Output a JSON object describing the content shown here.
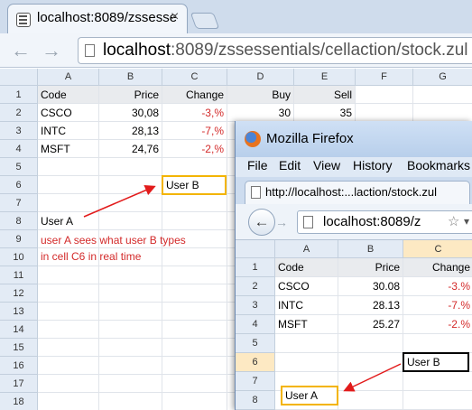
{
  "chrome": {
    "tab_title": "localhost:8089/zssesse",
    "tab_close": "×",
    "back": "←",
    "forward": "→",
    "url_host": "localhost",
    "url_rest": ":8089/zssessentials/cellaction/stock.zul"
  },
  "sheetA": {
    "cols": [
      "A",
      "B",
      "C",
      "D",
      "E",
      "F",
      "G"
    ],
    "rows": [
      "1",
      "2",
      "3",
      "4",
      "5",
      "6",
      "7",
      "8",
      "9",
      "10",
      "11",
      "12",
      "13",
      "14",
      "15",
      "16",
      "17",
      "18"
    ],
    "header": {
      "code": "Code",
      "price": "Price",
      "change": "Change",
      "buy": "Buy",
      "sell": "Sell"
    },
    "data": [
      {
        "code": "CSCO",
        "price": "30,08",
        "change": "-3,%",
        "buy": "30",
        "sell": "35"
      },
      {
        "code": "INTC",
        "price": "28,13",
        "change": "-7,%"
      },
      {
        "code": "MSFT",
        "price": "24,76",
        "change": "-2,%"
      }
    ],
    "user_b": "User B",
    "user_a": "User A",
    "note_line1": "user A sees what user B types",
    "note_line2": "in cell C6 in real time"
  },
  "firefox": {
    "title": "Mozilla Firefox",
    "menus": [
      "File",
      "Edit",
      "View",
      "History",
      "Bookmarks"
    ],
    "tab_title": "http://localhost:...laction/stock.zul",
    "back": "←",
    "forward": "→",
    "url": "localhost:8089/z",
    "star": "☆",
    "dropdown": "▾"
  },
  "sheetB": {
    "cols": [
      "A",
      "B",
      "C"
    ],
    "rows": [
      "1",
      "2",
      "3",
      "4",
      "5",
      "6",
      "7",
      "8"
    ],
    "header": {
      "code": "Code",
      "price": "Price",
      "change": "Change"
    },
    "data": [
      {
        "code": "CSCO",
        "price": "30.08",
        "change": "-3.%"
      },
      {
        "code": "INTC",
        "price": "28.13",
        "change": "-7.%"
      },
      {
        "code": "MSFT",
        "price": "25.27",
        "change": "-2.%"
      }
    ],
    "user_b": "User B",
    "user_a": "User A"
  },
  "colors": {
    "accent_red": "#d32a2a",
    "highlight_yellow": "#f3b400"
  }
}
